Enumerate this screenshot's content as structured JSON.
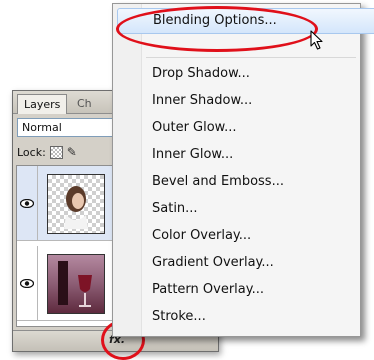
{
  "layers_panel": {
    "tabs": [
      {
        "label": "Layers"
      },
      {
        "label": "Ch"
      }
    ],
    "blend_mode": "Normal",
    "lock_label": "Lock:",
    "icons": {
      "visibility": "eye-icon",
      "fx": "fx-icon",
      "lock": "lock-transparency-icon",
      "brush": "brush-icon"
    }
  },
  "context_menu": {
    "items": [
      {
        "label": "Blending Options...",
        "highlighted": true
      },
      {
        "label": "Drop Shadow..."
      },
      {
        "label": "Inner Shadow..."
      },
      {
        "label": "Outer Glow..."
      },
      {
        "label": "Inner Glow..."
      },
      {
        "label": "Bevel and Emboss..."
      },
      {
        "label": "Satin..."
      },
      {
        "label": "Color Overlay..."
      },
      {
        "label": "Gradient Overlay..."
      },
      {
        "label": "Pattern Overlay..."
      },
      {
        "label": "Stroke..."
      }
    ]
  },
  "annotation_color": "#e0101a",
  "highlight_color": "#d4e6fb"
}
